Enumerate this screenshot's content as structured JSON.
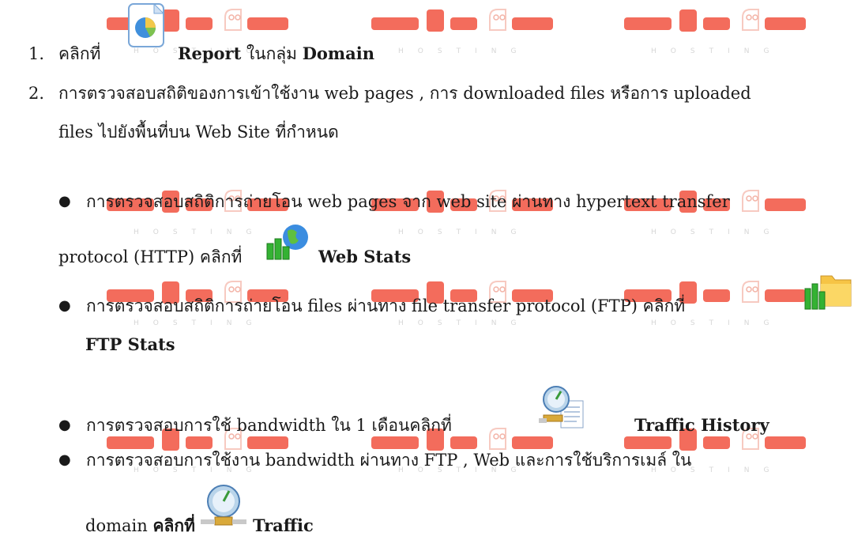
{
  "brand": {
    "color": "#f25c4a",
    "name": "chai",
    "tagline": "HOSTING"
  },
  "step1": {
    "number": "1.",
    "click": "คลิกที่",
    "label": "Report",
    "in_group": "ในกลุ่ม",
    "group": "Domain",
    "icon": "report-pie-icon"
  },
  "step2": {
    "number": "2.",
    "line1": "การตรวจสอบสถิติของการเข้าใช้งาน web pages , การ downloaded files หรือการ uploaded",
    "line2": "files ไปยังพื้นที่บน Web Site ที่กำหนด"
  },
  "bullets": [
    {
      "line1": "การตรวจสอบสถิติการถ่ายโอน web pages จาก web site ผ่านทาง hypertext transfer",
      "line2": "protocol (HTTP)   คลิกที่",
      "label": "Web Stats",
      "icon": "web-stats-icon"
    },
    {
      "line1": "การตรวจสอบสถิติการถ่ายโอน files ผ่านทาง file transfer protocol (FTP) คลิกที่",
      "label": "FTP Stats",
      "icon": "ftp-stats-icon"
    },
    {
      "line1": "การตรวจสอบการใช้ bandwidth ใน 1 เดือนคลิกที่",
      "label": "Traffic History",
      "icon": "traffic-history-icon"
    },
    {
      "line1": "การตรวจสอบการใช้งาน bandwidth ผ่านทาง  FTP , Web และการใช้บริการเมล์ ใน",
      "line2": "domain",
      "click": "คลิกที่",
      "label": "Traffic",
      "icon": "traffic-icon"
    }
  ]
}
